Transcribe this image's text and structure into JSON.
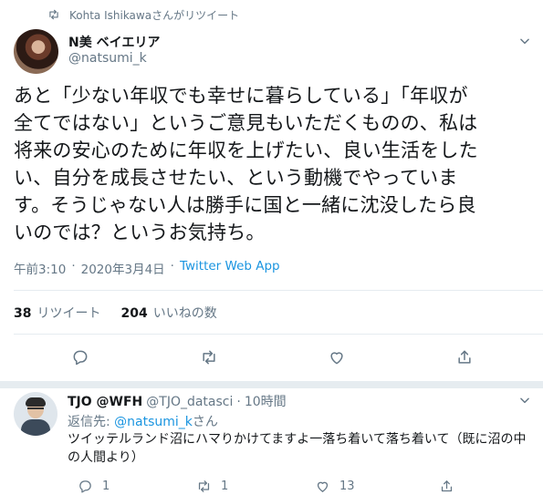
{
  "retweet_context": "Kohta Ishikawaさんがリツイート",
  "tweet": {
    "display_name": "N美 ベイエリア",
    "handle": "@natsumi_k",
    "text": "あと「少ない年収でも幸せに暮らしている」「年収が\n全てではない」というご意見もいただくものの、私は\n将来の安心のために年収を上げたい、良い生活をした\nい、自分を成長させたい、という動機でやっていま\nす。そうじゃない人は勝手に国と一緒に沈没したら良\nいのでは？というお気持ち。",
    "time": "午前3:10",
    "date": "2020年3月4日",
    "source": "Twitter Web App",
    "retweets_count": "38",
    "retweets_label": "リツイート",
    "likes_count": "204",
    "likes_label": "いいねの数"
  },
  "reply": {
    "display_name": "TJO @WFH",
    "handle": "@TJO_datasci",
    "time": "10時間",
    "replying_prefix": "返信先: ",
    "replying_to": "@natsumi_k",
    "replying_suffix": "さん",
    "text": "ツイッテルランド沼にハマりかけてますよ一落ち着いて落ち着いて（既に沼の中の人間より）",
    "reply_count": "1",
    "retweet_count": "1",
    "like_count": "13"
  },
  "icons": [
    "retweet-icon",
    "chevron-down-icon",
    "reply-icon",
    "heart-icon",
    "share-icon"
  ],
  "colors": {
    "link": "#1b95e0",
    "muted": "#657786",
    "text": "#14171a",
    "divider": "#e6ecf0"
  }
}
